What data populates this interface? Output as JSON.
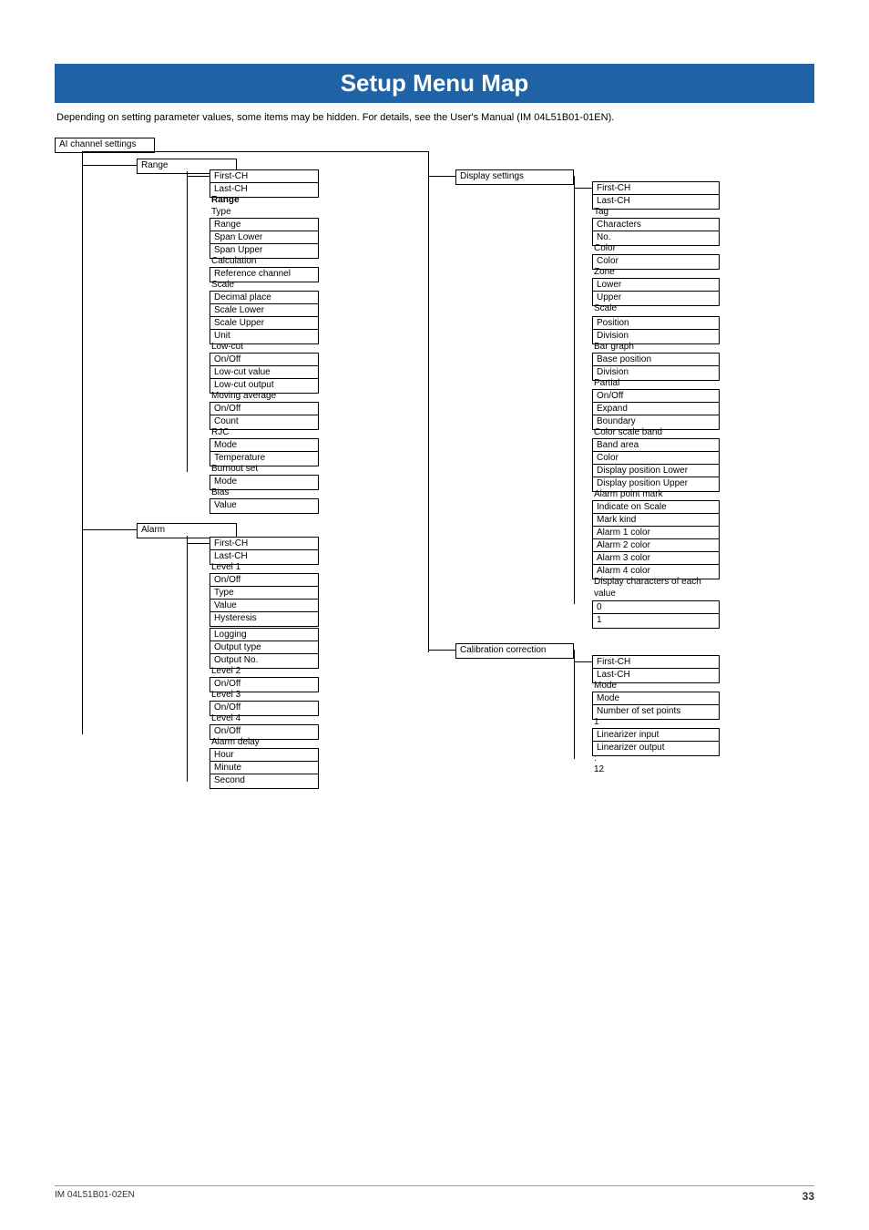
{
  "title": "Setup Menu Map",
  "subtitle": "Depending on setting parameter values, some items may be hidden. For details, see the User's Manual (IM 04L51B01-01EN).",
  "root": "AI channel settings",
  "node_range": "Range",
  "range_items": {
    "first": "First-CH",
    "last": "Last-CH",
    "range_b": "Range",
    "type": "Type",
    "range2": "Range",
    "span_l": "Span Lower",
    "span_u": "Span Upper",
    "calc": "Calculation",
    "ref": "Reference channel",
    "scale": "Scale",
    "dec": "Decimal place",
    "sl": "Scale Lower",
    "su": "Scale Upper",
    "unit": "Unit",
    "low_cut": "Low-cut",
    "oo1": "On/Off",
    "lcv": "Low-cut value",
    "lco": "Low-cut output",
    "mavg": "Moving average",
    "oo2": "On/Off",
    "count": "Count",
    "rjc": "RJC",
    "mode": "Mode",
    "temp": "Temperature",
    "burn": "Burnout set",
    "mode2": "Mode",
    "bias": "Bias",
    "value": "Value"
  },
  "node_alarm": "Alarm",
  "alarm_items": {
    "first": "First-CH",
    "last": "Last-CH",
    "l1": "Level 1",
    "oo1": "On/Off",
    "type": "Type",
    "val": "Value",
    "hys": "Hysteresis",
    "log": "Logging",
    "otype": "Output type",
    "ono": "Output No.",
    "l2": "Level 2",
    "oo2": "On/Off",
    "l3": "Level 3",
    "oo3": "On/Off",
    "l4": "Level 4",
    "oo4": "On/Off",
    "delay": "Alarm delay",
    "hr": "Hour",
    "min": "Minute",
    "sec": "Second"
  },
  "node_display": "Display settings",
  "disp": {
    "first": "First-CH",
    "last": "Last-CH",
    "tag": "Tag",
    "chars": "Characters",
    "no": "No.",
    "color_lbl": "Color",
    "color": "Color",
    "zone": "Zone",
    "lower": "Lower",
    "upper": "Upper",
    "scale": "Scale",
    "pos": "Position",
    "div": "Division",
    "bar": "Bar graph",
    "base": "Base position",
    "div2": "Division",
    "partial": "Partial",
    "oo": "On/Off",
    "expand": "Expand",
    "bound": "Boundary",
    "csb": "Color scale band",
    "band": "Band area",
    "color2": "Color",
    "dpl": "Display position Lower",
    "dpu": "Display position Upper",
    "apm": "Alarm point mark",
    "ios": "Indicate on Scale",
    "mk": "Mark kind",
    "a1": "Alarm 1 color",
    "a2": "Alarm 2 color",
    "a3": "Alarm 3 color",
    "a4": "Alarm 4 color",
    "dcev": "Display characters of each value",
    "zero": "0",
    "one": "1"
  },
  "node_calib": "Calibration correction",
  "calib": {
    "first": "First-CH",
    "last": "Last-CH",
    "mode_lbl": "Mode",
    "mode": "Mode",
    "nsp": "Number of set points",
    "n1": "1",
    "lin_in": "Linearizer input",
    "lin_out": "Linearizer output",
    "colon": ":",
    "n12": "12"
  },
  "footer_left": "IM 04L51B01-02EN",
  "footer_right": "33"
}
